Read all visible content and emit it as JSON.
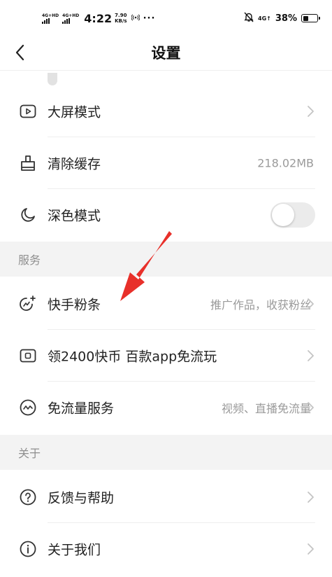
{
  "status_bar": {
    "sim1_label": "4G+HD",
    "sim2_label": "4G+HD",
    "time": "4:22",
    "speed_value": "7.90",
    "speed_unit": "KB/s",
    "hotspot_icon": "hotspot-icon",
    "more_dots": "···",
    "mute_icon": "bell-off-icon",
    "network_label": "4G↑",
    "battery_text": "38%",
    "battery_level": 0.38
  },
  "header": {
    "back_icon": "chevron-left-icon",
    "title": "设置"
  },
  "general": {
    "large_screen": {
      "label": "大屏模式",
      "icon": "play-screen-icon"
    },
    "clear_cache": {
      "label": "清除缓存",
      "value": "218.02MB",
      "icon": "eraser-icon"
    },
    "dark_mode": {
      "label": "深色模式",
      "icon": "moon-icon",
      "enabled": false
    }
  },
  "services": {
    "header": "服务",
    "kuaishou_fans": {
      "label": "快手粉条",
      "value": "推广作品，收获粉丝",
      "icon": "boost-icon"
    },
    "coins": {
      "label": "领2400快币 百款app免流玩",
      "icon": "coin-box-icon"
    },
    "free_data": {
      "label": "免流量服务",
      "value": "视频、直播免流量",
      "icon": "wave-icon"
    }
  },
  "about": {
    "header": "关于",
    "feedback": {
      "label": "反馈与帮助",
      "icon": "question-circle-icon"
    },
    "about_us": {
      "label": "关于我们",
      "icon": "info-circle-icon"
    }
  },
  "colors": {
    "annotation_arrow": "#e8302a",
    "section_bg": "#f3f3f3",
    "divider": "#eeeeee",
    "secondary_text": "#9a9a9a"
  }
}
